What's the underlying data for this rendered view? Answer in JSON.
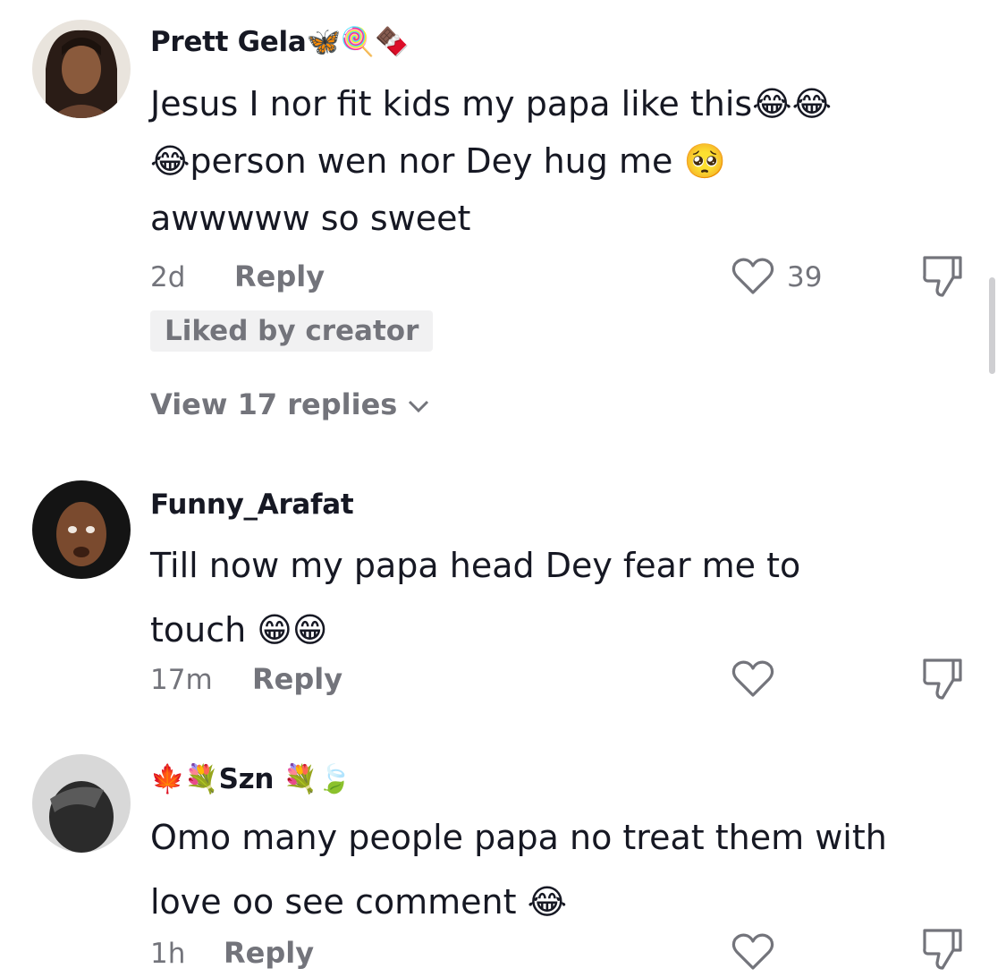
{
  "comments": [
    {
      "username": "Prett Gela🦋🍭🍫",
      "text_lines": [
        "Jesus I nor fit kids my papa like this😂😂",
        "😂person wen nor Dey hug me 🥺",
        "awwwww so sweet"
      ],
      "time": "2d",
      "reply_label": "Reply",
      "likes": "39",
      "badge": "Liked by creator",
      "view_replies": "View 17 replies"
    },
    {
      "username": "Funny_Arafat",
      "text_lines": [
        "Till now my papa head Dey fear me to",
        "touch 😁😁"
      ],
      "time": "17m",
      "reply_label": "Reply",
      "likes": ""
    },
    {
      "username": "🍁💐Szn 💐🍃",
      "text_lines": [
        "Omo many people papa no treat them with",
        "love oo see comment 😂"
      ],
      "time": "1h",
      "reply_label": "Reply",
      "likes": ""
    }
  ],
  "icons": {
    "like": "heart-outline-icon",
    "dislike": "thumbs-down-icon",
    "expand": "chevron-down-icon"
  },
  "colors": {
    "primary_text": "#161823",
    "secondary_text": "#73747b",
    "badge_bg": "#f1f1f2"
  }
}
